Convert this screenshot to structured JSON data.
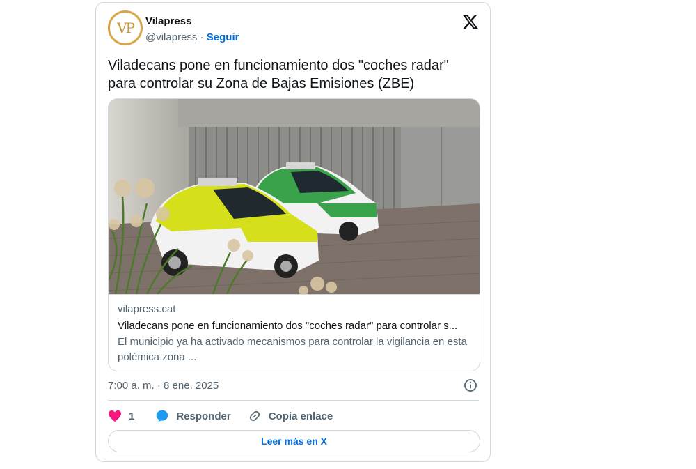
{
  "header": {
    "avatar_text": "VP",
    "name": "Vilapress",
    "handle": "@vilapress",
    "separator": " · ",
    "follow_label": "Seguir"
  },
  "tweet": {
    "text": "Viladecans pone en funcionamiento dos \"coches radar\" para controlar su Zona de Bajas Emisiones (ZBE)"
  },
  "link_card": {
    "domain": "vilapress.cat",
    "title": "Viladecans pone en funcionamiento dos \"coches radar\" para controlar s...",
    "description": "El municipio ya ha activado mecanismos para controlar la vigilancia en esta polémica zona ...",
    "image_alt": "Two radar cars, one yellow and one green, parked in front of a garage door"
  },
  "meta": {
    "timestamp": "7:00 a. m. · 8 ene. 2025"
  },
  "actions": {
    "like_count": "1",
    "reply_label": "Responder",
    "copy_label": "Copia enlace"
  },
  "read_more_label": "Leer más en X",
  "colors": {
    "accent": "#006fd6",
    "like": "#f91880",
    "reply": "#1d9bf0",
    "border": "#cfd9de",
    "secondary_text": "#536471"
  }
}
